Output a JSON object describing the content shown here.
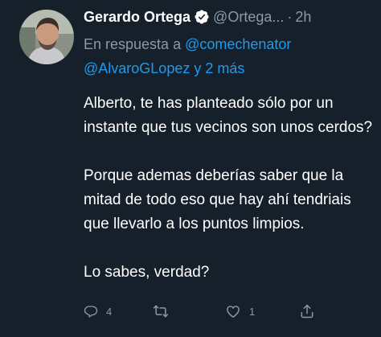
{
  "tweet": {
    "author": {
      "display_name": "Gerardo Ortega",
      "handle": "@Ortega...",
      "verified_icon": "verified-badge-icon",
      "avatar_icon": "profile-avatar"
    },
    "separator": "·",
    "time": "2h",
    "reply_to": {
      "prefix": "En respuesta a",
      "mention_1": "@comechenator",
      "mention_2": "@AlvaroGLopez",
      "suffix": "y 2 más"
    },
    "body": {
      "paragraph_1": "Alberto, te has planteado sólo por un instante que tus vecinos son unos cerdos?",
      "paragraph_2": "Porque ademas deberías saber que la mitad de todo eso que hay ahí tendriais que llevarlo a los puntos limpios.",
      "paragraph_3": "Lo sabes, verdad?"
    },
    "actions": {
      "reply_count": "4",
      "retweet_count": "",
      "like_count": "1",
      "share_count": ""
    }
  },
  "colors": {
    "background": "#15202b",
    "text": "#ffffff",
    "secondary": "#8b98a5",
    "accent": "#1d9bf0"
  }
}
